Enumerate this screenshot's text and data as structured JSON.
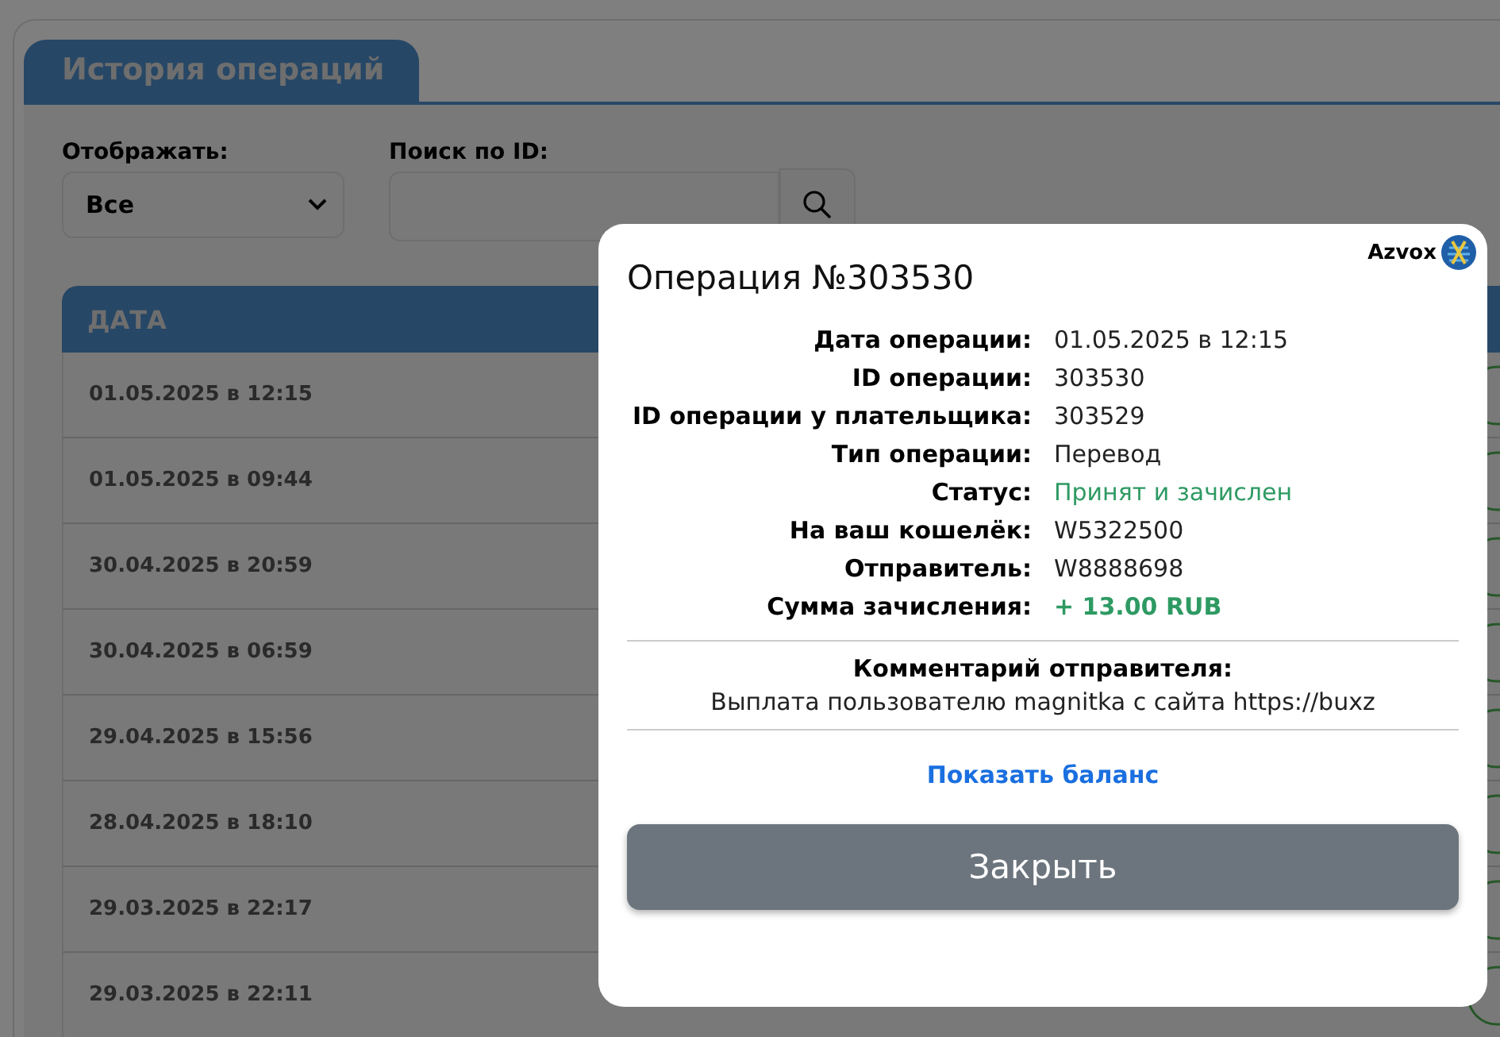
{
  "page": {
    "tab": "История операций"
  },
  "filters": {
    "display_label": "Отображать:",
    "display_value": "Все",
    "search_label": "Поиск по ID:"
  },
  "table": {
    "columns": [
      "ДАТА"
    ],
    "rows": [
      {
        "date": "01.05.2025 в 12:15"
      },
      {
        "date": "01.05.2025 в 09:44"
      },
      {
        "date": "30.04.2025 в 20:59"
      },
      {
        "date": "30.04.2025 в 06:59"
      },
      {
        "date": "29.04.2025 в 15:56"
      },
      {
        "date": "28.04.2025 в 18:10"
      },
      {
        "date": "29.03.2025 в 22:17"
      },
      {
        "date": "29.03.2025 в 22:11"
      }
    ]
  },
  "modal": {
    "brand": "Azvox",
    "title": "Операция №303530",
    "details": [
      {
        "label": "Дата операции:",
        "value": "01.05.2025 в 12:15",
        "kind": "plain"
      },
      {
        "label": "ID операции:",
        "value": "303530",
        "kind": "plain"
      },
      {
        "label": "ID операции у плательщика:",
        "value": "303529",
        "kind": "plain"
      },
      {
        "label": "Тип операции:",
        "value": "Перевод",
        "kind": "plain"
      },
      {
        "label": "Статус:",
        "value": "Принят и зачислен",
        "kind": "status"
      },
      {
        "label": "На ваш кошелёк:",
        "value": "W5322500",
        "kind": "plain"
      },
      {
        "label": "Отправитель:",
        "value": "W8888698",
        "kind": "plain"
      },
      {
        "label": "Сумма зачисления:",
        "value": "+ 13.00 RUB",
        "kind": "amount"
      }
    ],
    "comment_label": "Комментарий отправителя:",
    "comment": "Выплата пользователю magnitka с сайта https://buxz",
    "balance_link": "Показать баланс",
    "close_button": "Закрыть"
  }
}
